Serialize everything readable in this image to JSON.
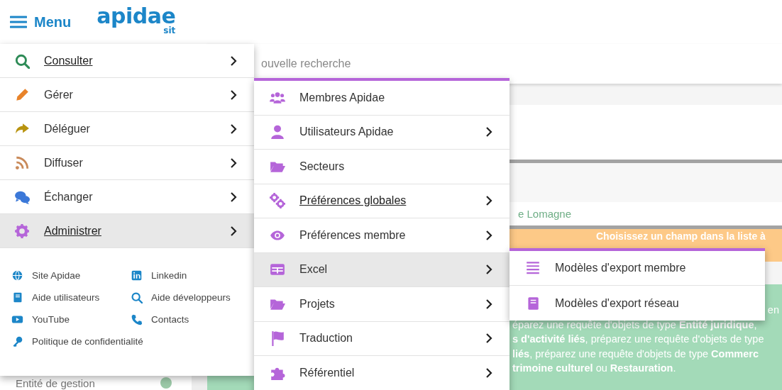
{
  "header": {
    "menu_label": "Menu",
    "logo": "apidae",
    "logo_sub": "sit"
  },
  "background": {
    "search_placeholder": "ouvelle recherche",
    "location": "e Lomagne",
    "banner": "Choisissez un champ dans la liste à",
    "info_lines": [
      "en",
      "éparez une requête d'objets de type **Entité juridique**,",
      "**s d'activité liés**, préparez une requête d'objets de type",
      "**liés**, préparez une requête d'objets de type **Commerc**",
      "**trimoine culturel** ou **Restauration**."
    ],
    "sidebar_item": "Entité de gestion"
  },
  "menu": {
    "items": [
      {
        "label": "Consulter",
        "color": "#2e8b57",
        "selected": false,
        "underlined": true
      },
      {
        "label": "Gérer",
        "color": "#e8832a",
        "selected": false,
        "underlined": false
      },
      {
        "label": "Déléguer",
        "color": "#b8930f",
        "selected": false,
        "underlined": false
      },
      {
        "label": "Diffuser",
        "color": "#c98a5a",
        "selected": false,
        "underlined": false
      },
      {
        "label": "Échanger",
        "color": "#3b78d8",
        "selected": false,
        "underlined": false
      },
      {
        "label": "Administrer",
        "color": "#b565d9",
        "selected": true,
        "underlined": true
      }
    ],
    "links": [
      "Site Apidae",
      "Linkedin",
      "Aide utilisateurs",
      "Aide développeurs",
      "YouTube",
      "Contacts",
      "Politique de confidentialité"
    ]
  },
  "submenu": {
    "items": [
      {
        "label": "Membres Apidae",
        "has_children": false,
        "selected": false,
        "underlined": false
      },
      {
        "label": "Utilisateurs Apidae",
        "has_children": true,
        "selected": false,
        "underlined": false
      },
      {
        "label": "Secteurs",
        "has_children": false,
        "selected": false,
        "underlined": false
      },
      {
        "label": "Préférences globales",
        "has_children": true,
        "selected": false,
        "underlined": true
      },
      {
        "label": "Préférences membre",
        "has_children": true,
        "selected": false,
        "underlined": false
      },
      {
        "label": "Excel",
        "has_children": true,
        "selected": true,
        "underlined": false
      },
      {
        "label": "Projets",
        "has_children": true,
        "selected": false,
        "underlined": false
      },
      {
        "label": "Traduction",
        "has_children": true,
        "selected": false,
        "underlined": false
      },
      {
        "label": "Référentiel",
        "has_children": true,
        "selected": false,
        "underlined": false
      }
    ]
  },
  "submenu_2": {
    "items": [
      "Modèles d'export membre",
      "Modèles d'export réseau"
    ]
  }
}
